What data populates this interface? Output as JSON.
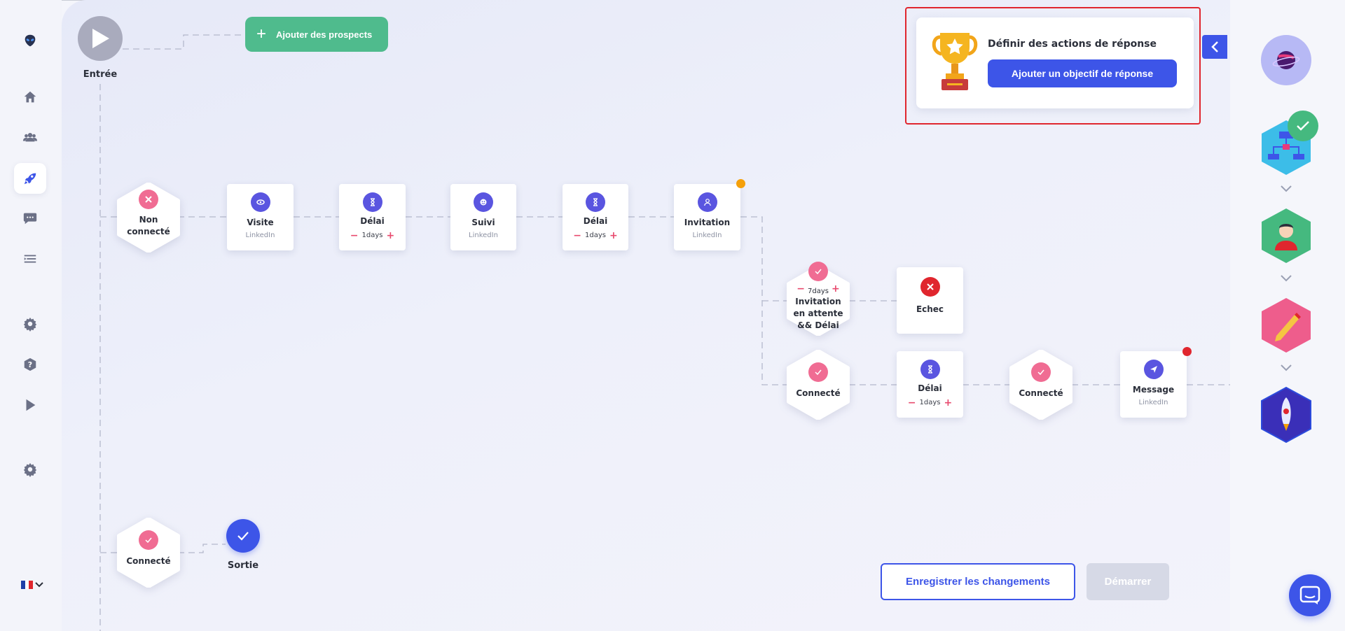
{
  "entry": {
    "label": "Entrée"
  },
  "add_prospects": {
    "label": "Ajouter des prospects"
  },
  "flow": {
    "non_connecte": "Non\nconnecté",
    "visite": {
      "title": "Visite",
      "sub": "LinkedIn"
    },
    "delai1": {
      "title": "Délai",
      "value": "1days"
    },
    "suivi": {
      "title": "Suivi",
      "sub": "LinkedIn"
    },
    "delai2": {
      "title": "Délai",
      "value": "1days"
    },
    "invitation": {
      "title": "Invitation",
      "sub": "LinkedIn"
    },
    "pending": {
      "value": "7days",
      "label": "Invitation\nen attente\n&& Délai"
    },
    "echec": {
      "title": "Echec"
    },
    "connecte1": "Connecté",
    "delai3": {
      "title": "Délai",
      "value": "1days"
    },
    "connecte2": "Connecté",
    "message": {
      "title": "Message",
      "sub": "LinkedIn"
    },
    "connecte3": "Connecté",
    "exit": "Sortie"
  },
  "goal": {
    "title": "Définir des actions de réponse",
    "button": "Ajouter un objectif de réponse"
  },
  "footer": {
    "save": "Enregistrer les changements",
    "start": "Démarrer"
  },
  "colors": {
    "accent": "#3d55e8",
    "step_icon": "#5a55e0",
    "success": "#4fbb8d",
    "pink": "#f06c93",
    "error": "#e0262e",
    "warning": "#f5a00a"
  },
  "icons": {
    "sidebar": [
      "alien-logo-icon",
      "home-icon",
      "users-icon",
      "rocket-icon",
      "chat-icon",
      "list-icon",
      "gear-icon",
      "help-icon",
      "play-icon",
      "settings-icon"
    ],
    "language": "french-flag-icon"
  }
}
